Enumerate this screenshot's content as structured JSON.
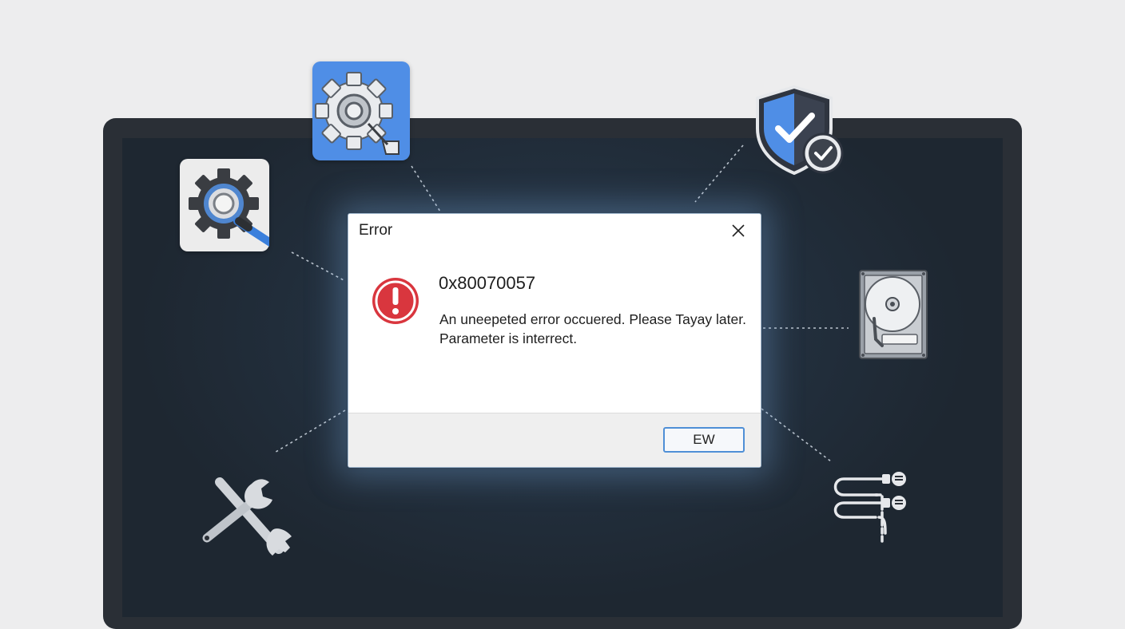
{
  "dialog": {
    "title": "Error",
    "close_icon": "close-icon",
    "error_icon": "error-exclamation-icon",
    "error_code": "0x80070057",
    "message_line1": "An uneepeted error occuered. Please Tayay later.",
    "message_line2": "Parameter is interrect.",
    "ok_button_label": "EW"
  },
  "floating_icons": [
    "gear-search-icon",
    "settings-gear-icon",
    "security-shield-icon",
    "hard-drive-icon",
    "tools-icon",
    "cables-icon"
  ],
  "colors": {
    "error_red": "#d9363e",
    "accent_blue": "#4f8ee6",
    "screen_dark": "#1e2731"
  }
}
